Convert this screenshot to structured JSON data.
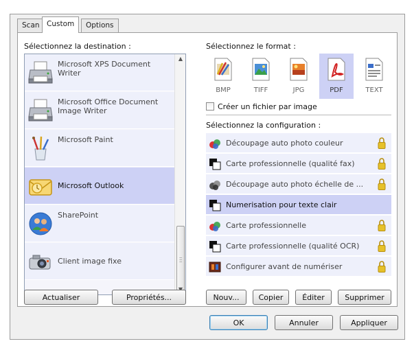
{
  "tabs": [
    {
      "label": "Scan",
      "active": false
    },
    {
      "label": "Custom",
      "active": true
    },
    {
      "label": "Options",
      "active": false
    }
  ],
  "destination": {
    "label": "Sélectionnez la destination :",
    "items": [
      {
        "label": "Microsoft XPS Document Writer",
        "icon": "printer-icon",
        "selected": false
      },
      {
        "label": "Microsoft Office Document Image Writer",
        "icon": "printer-icon",
        "selected": false
      },
      {
        "label": "Microsoft Paint",
        "icon": "paint-brushes-icon",
        "selected": false
      },
      {
        "label": "Microsoft Outlook",
        "icon": "outlook-envelope-icon",
        "selected": true
      },
      {
        "label": "SharePoint",
        "icon": "sharepoint-people-icon",
        "selected": false
      },
      {
        "label": "Client image fixe",
        "icon": "camera-icon",
        "selected": false
      }
    ],
    "buttons": {
      "refresh": "Actualiser",
      "properties": "Propriétés..."
    }
  },
  "format": {
    "label": "Sélectionnez le format :",
    "items": [
      {
        "label": "BMP",
        "icon": "bmp-file-icon",
        "selected": false
      },
      {
        "label": "TIFF",
        "icon": "tiff-file-icon",
        "selected": false
      },
      {
        "label": "JPG",
        "icon": "jpg-file-icon",
        "selected": false
      },
      {
        "label": "PDF",
        "icon": "pdf-file-icon",
        "selected": true
      },
      {
        "label": "TEXT",
        "icon": "text-file-icon",
        "selected": false
      }
    ],
    "checkbox_label": "Créer un fichier par image",
    "checkbox_checked": false
  },
  "configuration": {
    "label": "Sélectionnez la configuration :",
    "items": [
      {
        "label": "Découpage auto photo couleur",
        "icon": "color-photo-icon",
        "locked": true,
        "selected": false
      },
      {
        "label": "Carte professionnelle (qualité fax)",
        "icon": "bw-document-icon",
        "locked": true,
        "selected": false
      },
      {
        "label": "Découpage auto photo échelle de ...",
        "icon": "gray-photo-icon",
        "locked": true,
        "selected": false
      },
      {
        "label": "Numerisation pour texte clair",
        "icon": "bw-document-icon",
        "locked": false,
        "selected": true
      },
      {
        "label": "Carte professionnelle",
        "icon": "color-photo-icon",
        "locked": true,
        "selected": false
      },
      {
        "label": "Carte professionnelle (qualité OCR)",
        "icon": "bw-document-icon",
        "locked": true,
        "selected": false
      },
      {
        "label": "Configurer avant de numériser",
        "icon": "film-strip-icon",
        "locked": true,
        "selected": false
      }
    ],
    "buttons": {
      "new": "Nouv...",
      "copy": "Copier",
      "edit": "Éditer",
      "delete": "Supprimer"
    }
  },
  "dialog_buttons": {
    "ok": "OK",
    "cancel": "Annuler",
    "apply": "Appliquer"
  },
  "colors": {
    "selection": "#cdd1f5",
    "item_bg": "#eef0fb",
    "default_button_border": "#3c7fb1",
    "lock_gold": "#e6c12a"
  }
}
